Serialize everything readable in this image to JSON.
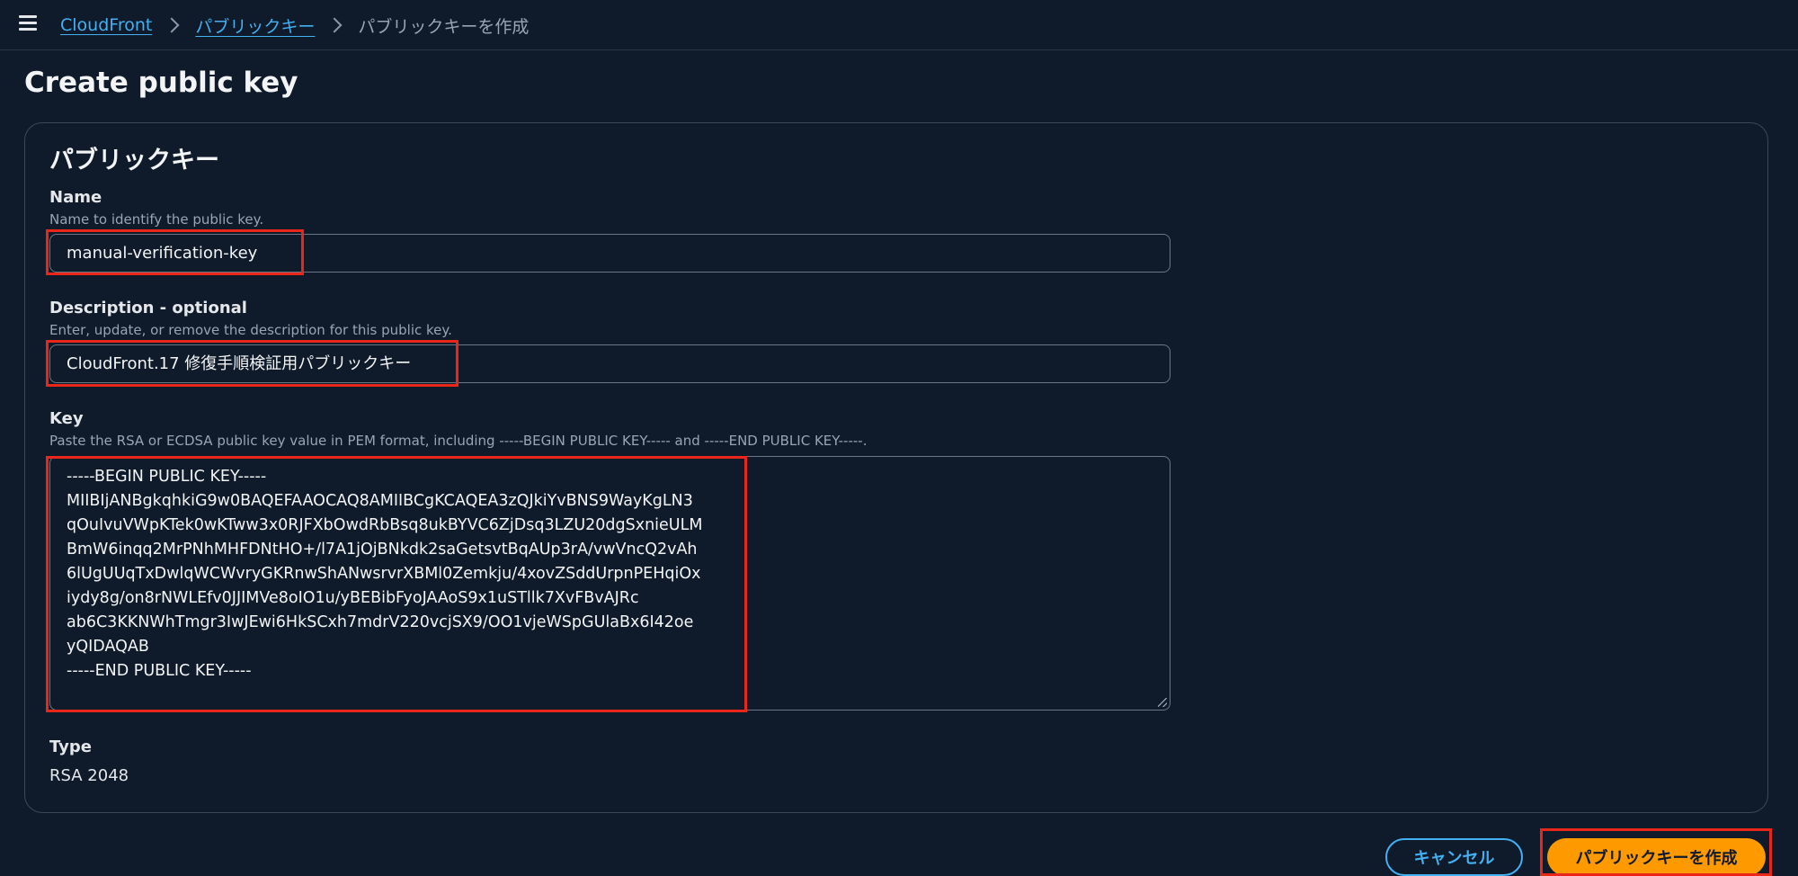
{
  "breadcrumb": {
    "items": [
      "CloudFront",
      "パブリックキー"
    ],
    "current": "パブリックキーを作成"
  },
  "page": {
    "title": "Create public key"
  },
  "form": {
    "section_title": "パブリックキー",
    "name": {
      "label": "Name",
      "description": "Name to identify the public key.",
      "value": "manual-verification-key"
    },
    "description": {
      "label": "Description - optional",
      "description": "Enter, update, or remove the description for this public key.",
      "value": "CloudFront.17 修復手順検証用パブリックキー"
    },
    "key": {
      "label": "Key",
      "description": "Paste the RSA or ECDSA public key value in PEM format, including -----BEGIN PUBLIC KEY----- and -----END PUBLIC KEY-----.",
      "lines": [
        "-----BEGIN PUBLIC KEY-----",
        "MIIBIjANBgkqhkiG9w0BAQEFAAOCAQ8AMIIBCgKCAQEA3zQJkiYvBNS9WayKgLN3",
        "qOuIvuVWpKTek0wKTww3x0RJFXbOwdRbBsq8ukBYVC6ZjDsq3LZU20dgSxnieULM",
        "BmW6inqq2MrPNhMHFDNtHO+/l7A1jOjBNkdk2saGetsvtBqAUp3rA/vwVncQ2vAh",
        "6lUgUUqTxDwlqWCWvryGKRnwShANwsrvrXBMl0Zemkju/4xovZSddUrpnPEHqiOx",
        "iydy8g/on8rNWLEfv0JJIMVe8oIO1u/yBEBibFyoJAAoS9x1uSTllk7XvFBvAJRc",
        "ab6C3KKNWhTmgr3IwJEwi6HkSCxh7mdrV220vcjSX9/OO1vjeWSpGUlaBx6I42oe",
        "yQIDAQAB",
        "-----END PUBLIC KEY-----"
      ]
    },
    "type": {
      "label": "Type",
      "value": "RSA 2048"
    }
  },
  "actions": {
    "cancel_label": "キャンセル",
    "create_label": "パブリックキーを作成"
  },
  "colors": {
    "background": "#0f1b2a",
    "link": "#43b0f1",
    "primary_button": "#ff9900",
    "annotation": "#e8261a"
  },
  "icons": {
    "menu": "hamburger-menu-icon",
    "separator": "chevron-right-icon",
    "resize": "resize-grip-icon"
  }
}
